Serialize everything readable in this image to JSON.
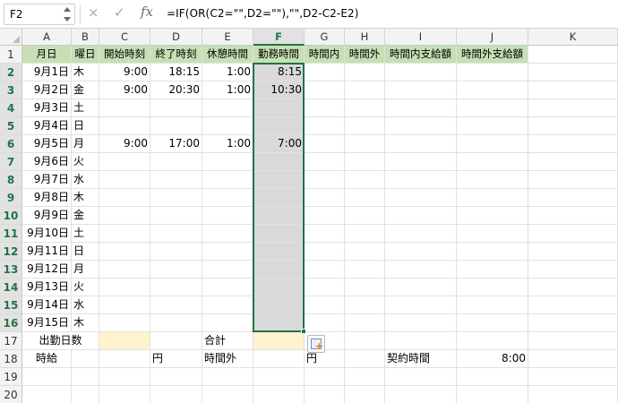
{
  "formula_bar": {
    "name_box": "F2",
    "cancel_icon": "×",
    "enter_icon": "✓",
    "fx_label": "fx",
    "formula": "=IF(OR(C2=\"\",D2=\"\"),\"\",D2-C2-E2)"
  },
  "columns": [
    "A",
    "B",
    "C",
    "D",
    "E",
    "F",
    "G",
    "H",
    "I",
    "J",
    "K"
  ],
  "selected_column": "F",
  "rows": [
    "1",
    "2",
    "3",
    "4",
    "5",
    "6",
    "7",
    "8",
    "9",
    "10",
    "11",
    "12",
    "13",
    "14",
    "15",
    "16",
    "17",
    "18",
    "19",
    "20"
  ],
  "headers": [
    "月日",
    "曜日",
    "開始時刻",
    "終了時刻",
    "休憩時間",
    "勤務時間",
    "時間内",
    "時間外",
    "時間内支給額",
    "時間外支給額"
  ],
  "data_rows": [
    {
      "date": "9月1日",
      "dow": "木",
      "start": "9:00",
      "end": "18:15",
      "break": "1:00",
      "work": "8:15"
    },
    {
      "date": "9月2日",
      "dow": "金",
      "start": "9:00",
      "end": "20:30",
      "break": "1:00",
      "work": "10:30"
    },
    {
      "date": "9月3日",
      "dow": "土",
      "start": "",
      "end": "",
      "break": "",
      "work": ""
    },
    {
      "date": "9月4日",
      "dow": "日",
      "start": "",
      "end": "",
      "break": "",
      "work": ""
    },
    {
      "date": "9月5日",
      "dow": "月",
      "start": "9:00",
      "end": "17:00",
      "break": "1:00",
      "work": "7:00"
    },
    {
      "date": "9月6日",
      "dow": "火",
      "start": "",
      "end": "",
      "break": "",
      "work": ""
    },
    {
      "date": "9月7日",
      "dow": "水",
      "start": "",
      "end": "",
      "break": "",
      "work": ""
    },
    {
      "date": "9月8日",
      "dow": "木",
      "start": "",
      "end": "",
      "break": "",
      "work": ""
    },
    {
      "date": "9月9日",
      "dow": "金",
      "start": "",
      "end": "",
      "break": "",
      "work": ""
    },
    {
      "date": "9月10日",
      "dow": "土",
      "start": "",
      "end": "",
      "break": "",
      "work": ""
    },
    {
      "date": "9月11日",
      "dow": "日",
      "start": "",
      "end": "",
      "break": "",
      "work": ""
    },
    {
      "date": "9月12日",
      "dow": "月",
      "start": "",
      "end": "",
      "break": "",
      "work": ""
    },
    {
      "date": "9月13日",
      "dow": "火",
      "start": "",
      "end": "",
      "break": "",
      "work": ""
    },
    {
      "date": "9月14日",
      "dow": "水",
      "start": "",
      "end": "",
      "break": "",
      "work": ""
    },
    {
      "date": "9月15日",
      "dow": "木",
      "start": "",
      "end": "",
      "break": "",
      "work": ""
    }
  ],
  "summary": {
    "attendance_days_label": "出勤日数",
    "total_label": "合計",
    "hourly_wage_label": "時給",
    "yen_label_1": "円",
    "overtime_label": "時間外",
    "yen_label_2": "円",
    "contract_hours_label": "契約時間",
    "contract_hours_value": "8:00"
  },
  "colors": {
    "header_fill": "#c6e0b4",
    "input_fill": "#fff2cc",
    "selection_fill": "#d9d9d9",
    "accent": "#217346"
  }
}
